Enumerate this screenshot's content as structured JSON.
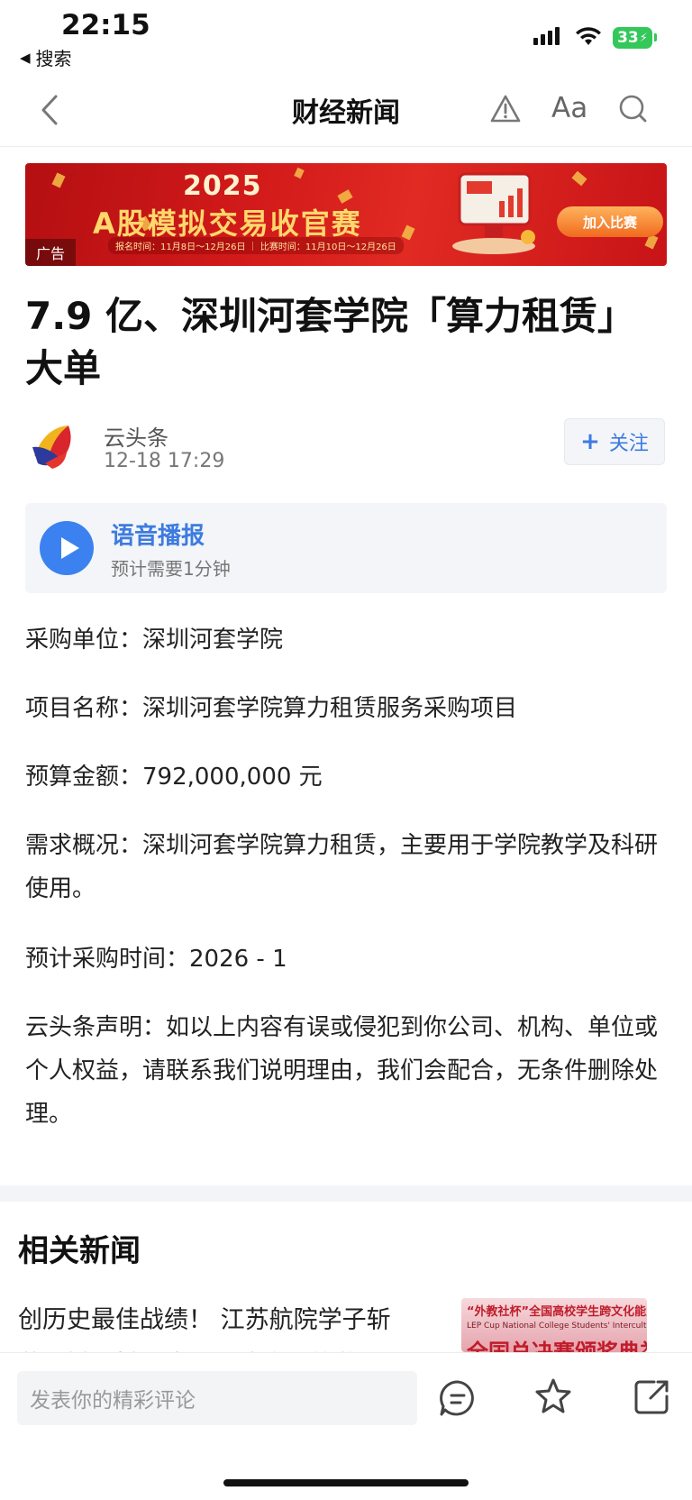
{
  "status_bar": {
    "time": "22:15",
    "back_app_label": "搜索",
    "battery": "33"
  },
  "nav": {
    "title": "财经新闻",
    "font_label": "Aa"
  },
  "ad": {
    "year": "2025",
    "title": "A股模拟交易收官赛",
    "dates": "报名时间：11月8日～12月26日 ｜ 比赛时间：11月10日～12月26日",
    "badge": "广告",
    "join_label": "加入比赛"
  },
  "article": {
    "headline": "7.9 亿、深圳河套学院「算力租赁」大单",
    "author": "云头条",
    "time": "12-18 17:29",
    "follow_label": "关注",
    "audio_title": "语音播报",
    "audio_sub": "预计需要1分钟",
    "paragraphs": [
      "采购单位：深圳河套学院",
      "项目名称：深圳河套学院算力租赁服务采购项目",
      "预算金额：792,000,000 元",
      "需求概况：深圳河套学院算力租赁，主要用于学院教学及科研使用。",
      "预计采购时间：2026 - 1",
      "云头条声明：如以上内容有误或侵犯到你公司、机构、单位或个人权益，请联系我们说明理由，我们会配合，无条件删除处理。"
    ]
  },
  "related": {
    "title": "相关新闻",
    "items": [
      {
        "text": "创历史最佳战绩！ 江苏航院学子斩获“外教社杯”全国总决赛三等奖",
        "thumb_text": "“外教社杯”全国高校学生跨文化能力大",
        "thumb_sub": "LEP Cup National College Students' Intercultural Competence",
        "thumb_big": "全国总决赛颁奖典礼"
      }
    ]
  },
  "bottom_bar": {
    "comment_placeholder": "发表你的精彩评论"
  },
  "colors": {
    "accent": "#3d7be0",
    "battery": "#34c759",
    "ad_red": "#d21a1a"
  }
}
